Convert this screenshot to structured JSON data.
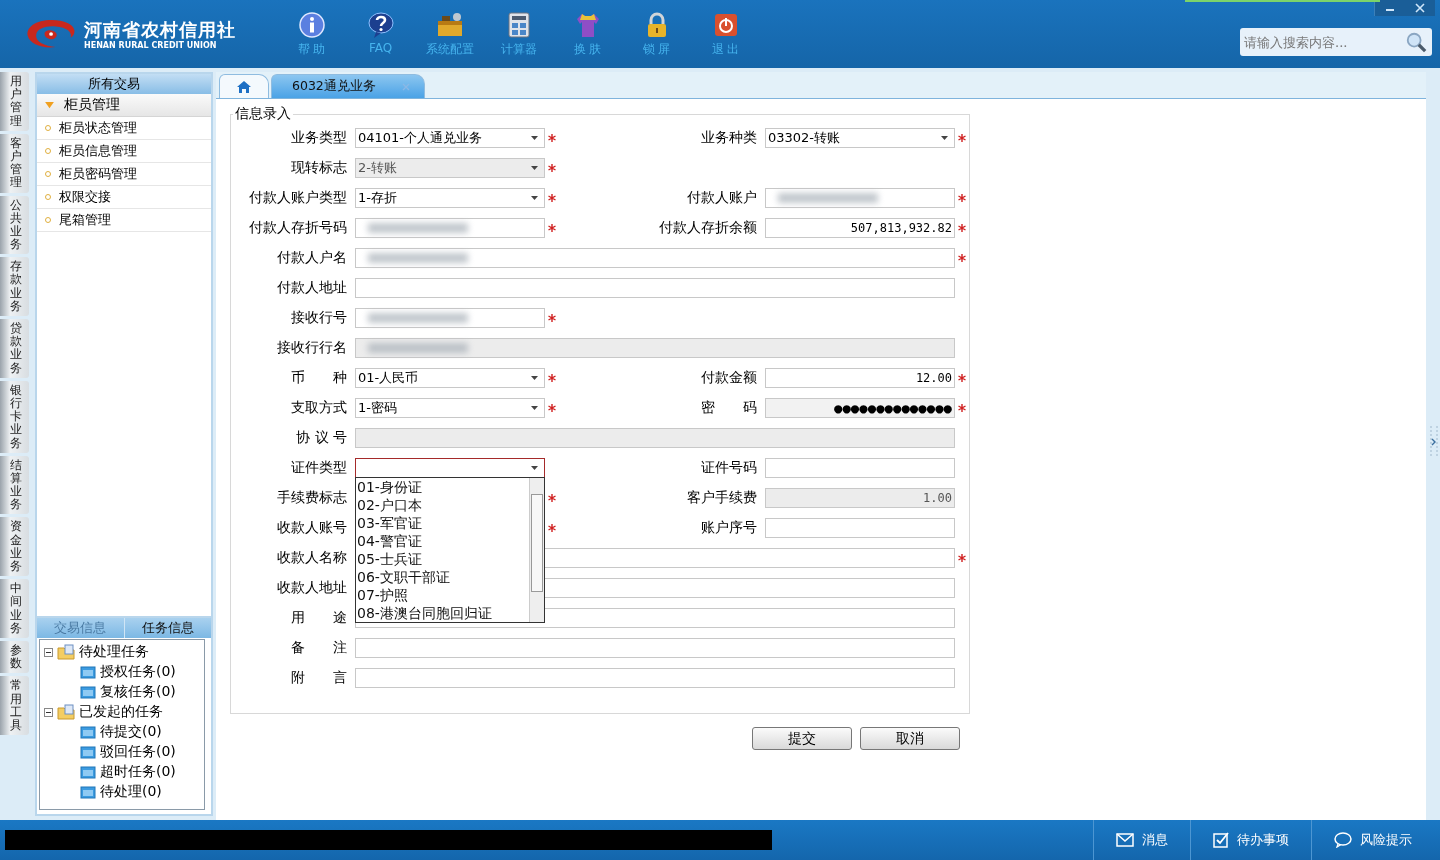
{
  "header": {
    "logo_title": "河南省农村信用社",
    "logo_subtitle": "HENAN RURAL CREDIT UNION",
    "toolbar": [
      {
        "label": "帮 助",
        "kind": "help"
      },
      {
        "label": "FAQ",
        "kind": "faq"
      },
      {
        "label": "系统配置",
        "kind": "config"
      },
      {
        "label": "计算器",
        "kind": "calculator"
      },
      {
        "label": "换 肤",
        "kind": "skin"
      },
      {
        "label": "锁 屏",
        "kind": "lock"
      },
      {
        "label": "退 出",
        "kind": "exit"
      }
    ],
    "search": {
      "placeholder": "请输入搜索内容..."
    }
  },
  "side_tabs": [
    "用户管理",
    "客户管理",
    "公共业务",
    "存款业务",
    "贷款业务",
    "银行卡业务",
    "结算业务",
    "资金业务",
    "中间业务",
    "参数",
    "常用工具"
  ],
  "menu": {
    "title": "所有交易",
    "group": {
      "label": "柜员管理",
      "expanded": true
    },
    "items": [
      "柜员状态管理",
      "柜员信息管理",
      "柜员密码管理",
      "权限交接",
      "尾箱管理"
    ]
  },
  "info_tabs": [
    {
      "label": "交易信息",
      "selected": false
    },
    {
      "label": "任务信息",
      "selected": true
    }
  ],
  "tree": [
    {
      "label": "待处理任务",
      "expanded": true,
      "children": [
        {
          "label": "授权任务(0)"
        },
        {
          "label": "复核任务(0)"
        }
      ]
    },
    {
      "label": "已发起的任务",
      "expanded": true,
      "children": [
        {
          "label": "待提交(0)"
        },
        {
          "label": "驳回任务(0)"
        },
        {
          "label": "超时任务(0)"
        },
        {
          "label": "待处理(0)"
        }
      ]
    }
  ],
  "page_tabs": [
    {
      "kind": "home",
      "selected": false
    },
    {
      "kind": "page",
      "label": "6032通兑业务",
      "selected": true
    }
  ],
  "form": {
    "legend": "信息录入",
    "rows": [
      [
        {
          "label": "业务类型",
          "kind": "select",
          "value": "04101-个人通兑业务",
          "required": true,
          "disabled": false,
          "expanded": false
        },
        {
          "label": "业务种类",
          "kind": "select",
          "value": "03302-转账",
          "required": true,
          "disabled": false,
          "expanded": false
        }
      ],
      [
        {
          "label": "现转标志",
          "kind": "select",
          "value": "2-转账",
          "required": true,
          "disabled": true,
          "expanded": false
        }
      ],
      [
        {
          "label": "付款人账户类型",
          "kind": "select",
          "value": "1-存折",
          "required": true,
          "disabled": false,
          "expanded": false
        },
        {
          "label": "付款人账户",
          "kind": "input",
          "required": true,
          "disabled": false,
          "redacted": true
        }
      ],
      [
        {
          "label": "付款人存折号码",
          "kind": "input",
          "required": true,
          "disabled": false,
          "redacted": true
        },
        {
          "label": "付款人存折余额",
          "kind": "amount",
          "value": "507,813,932.82",
          "required": true,
          "disabled": false
        }
      ],
      [
        {
          "label": "付款人户名",
          "kind": "wide",
          "required": true,
          "disabled": false,
          "redacted": true
        }
      ],
      [
        {
          "label": "付款人地址",
          "kind": "wide",
          "required": false,
          "disabled": false
        }
      ],
      [
        {
          "label": "接收行号",
          "kind": "input",
          "required": true,
          "disabled": false,
          "redacted": true
        }
      ],
      [
        {
          "label": "接收行行名",
          "kind": "wide",
          "required": false,
          "disabled": true,
          "redacted": true
        }
      ],
      [
        {
          "label": "币　　种",
          "kind": "select",
          "value": "01-人民币",
          "required": true,
          "disabled": false,
          "expanded": false
        },
        {
          "label": "付款金额",
          "kind": "amount",
          "value": "12.00",
          "required": true,
          "disabled": false
        }
      ],
      [
        {
          "label": "支取方式",
          "kind": "select",
          "value": "1-密码",
          "required": true,
          "disabled": false,
          "expanded": false
        },
        {
          "label": "密　　码",
          "kind": "password",
          "value": "●●●●●●●●●●●●●●",
          "required": true,
          "disabled": false
        }
      ],
      [
        {
          "label": "协 议 号",
          "kind": "wide",
          "required": false,
          "disabled": true
        }
      ],
      [
        {
          "label": "证件类型",
          "kind": "select",
          "required": false,
          "disabled": false,
          "expanded": true
        },
        {
          "label": "证件号码",
          "kind": "input",
          "required": false,
          "disabled": false
        }
      ],
      [
        {
          "label": "手续费标志",
          "kind": "covered",
          "required": true
        },
        {
          "label": "客户手续费",
          "kind": "amount",
          "value": "1.00",
          "required": false,
          "disabled": true
        }
      ],
      [
        {
          "label": "收款人账号",
          "kind": "covered",
          "required": true
        },
        {
          "label": "账户序号",
          "kind": "input",
          "required": false,
          "disabled": false
        }
      ],
      [
        {
          "label": "收款人名称",
          "kind": "wide",
          "required": true,
          "disabled": false
        }
      ],
      [
        {
          "label": "收款人地址",
          "kind": "wide",
          "required": false,
          "disabled": false
        }
      ],
      [
        {
          "label": "用　　途",
          "kind": "wide",
          "required": false,
          "disabled": false
        }
      ],
      [
        {
          "label": "备　　注",
          "kind": "wide",
          "required": false,
          "disabled": false
        }
      ],
      [
        {
          "label": "附　　言",
          "kind": "wide",
          "required": false,
          "disabled": false
        }
      ]
    ],
    "dropdown_options": [
      "01-身份证",
      "02-户口本",
      "03-军官证",
      "04-警官证",
      "05-士兵证",
      "06-文职干部证",
      "07-护照",
      "08-港澳台同胞回归证"
    ],
    "buttons": [
      "提交",
      "取消"
    ]
  },
  "status_bar": [
    {
      "label": "消息",
      "kind": "message"
    },
    {
      "label": "待办事项",
      "kind": "todo"
    },
    {
      "label": "风险提示",
      "kind": "risk"
    }
  ]
}
